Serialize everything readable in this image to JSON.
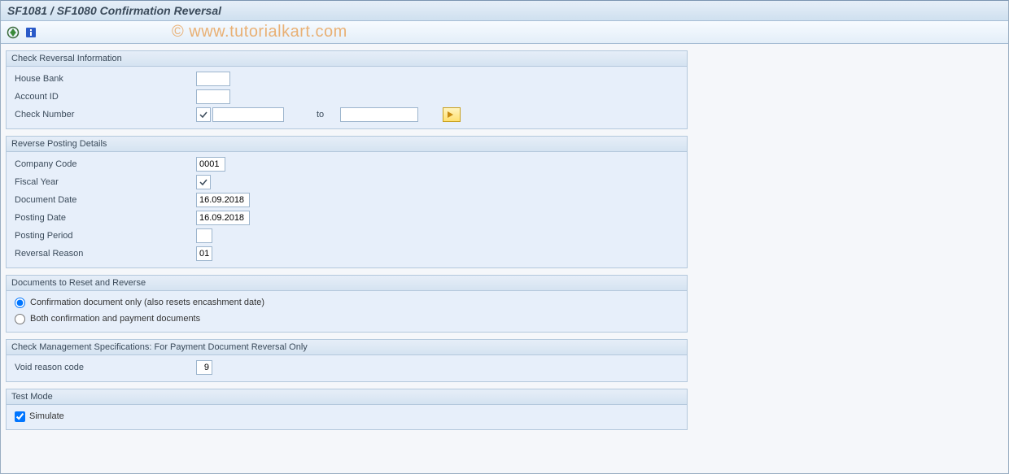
{
  "title": "SF1081 / SF1080 Confirmation Reversal",
  "watermark": "©  www.tutorialkart.com",
  "toolbar": {
    "execute_tip": "Execute",
    "info_tip": "Information"
  },
  "group1": {
    "header": "Check Reversal Information",
    "house_bank_label": "House Bank",
    "house_bank_value": "",
    "account_id_label": "Account ID",
    "account_id_value": "",
    "check_number_label": "Check Number",
    "check_number_from": "",
    "to_label": "to",
    "check_number_to": ""
  },
  "group2": {
    "header": "Reverse Posting Details",
    "company_code_label": "Company Code",
    "company_code_value": "0001",
    "fiscal_year_label": "Fiscal Year",
    "fiscal_year_value": "",
    "document_date_label": "Document Date",
    "document_date_value": "16.09.2018",
    "posting_date_label": "Posting Date",
    "posting_date_value": "16.09.2018",
    "posting_period_label": "Posting Period",
    "posting_period_value": "",
    "reversal_reason_label": "Reversal Reason",
    "reversal_reason_value": "01"
  },
  "group3": {
    "header": "Documents to Reset and Reverse",
    "option1": "Confirmation document only (also resets encashment date)",
    "option2": "Both confirmation and payment documents",
    "selected": "option1"
  },
  "group4": {
    "header": "Check Management Specifications: For Payment Document Reversal Only",
    "void_reason_label": "Void reason code",
    "void_reason_value": "9"
  },
  "group5": {
    "header": "Test Mode",
    "simulate_label": "Simulate",
    "simulate_checked": true
  }
}
